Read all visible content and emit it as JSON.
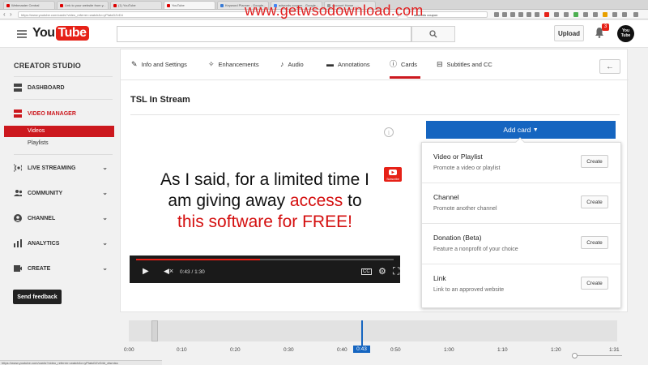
{
  "browser": {
    "tabs": [
      {
        "label": "Webmaster Central"
      },
      {
        "label": "Link to your website from y..."
      },
      {
        "label": "(1) YouTube"
      },
      {
        "label": "YouTube"
      },
      {
        "label": "Keyword Planner - Google..."
      },
      {
        "label": "adwords coupon - Google..."
      },
      {
        "label": "Account Home - ..."
      }
    ],
    "url": "https://www.youtube.com/cards?video_referrer=watch&v=yPlatoDZvD4",
    "search_value": "adwords coupon",
    "status_url": "https://www.youtube.com/cards?video_referrer=watch&v=yPlatoDZvD4#_dismiss"
  },
  "watermark": "www.getwsodownload.com",
  "header": {
    "logo_you": "You",
    "logo_tube": "Tube",
    "upload_label": "Upload",
    "notification_count": "3",
    "avatar_text": "You Tube"
  },
  "sidebar": {
    "title": "CREATOR STUDIO",
    "items": [
      {
        "label": "DASHBOARD"
      },
      {
        "label": "VIDEO MANAGER"
      },
      {
        "label": "LIVE STREAMING"
      },
      {
        "label": "COMMUNITY"
      },
      {
        "label": "CHANNEL"
      },
      {
        "label": "ANALYTICS"
      },
      {
        "label": "CREATE"
      }
    ],
    "subitems": [
      {
        "label": "Videos"
      },
      {
        "label": "Playlists"
      }
    ],
    "feedback_label": "Send feedback"
  },
  "tabs": [
    {
      "label": "Info and Settings"
    },
    {
      "label": "Enhancements"
    },
    {
      "label": "Audio"
    },
    {
      "label": "Annotations"
    },
    {
      "label": "Cards"
    },
    {
      "label": "Subtitles and CC"
    }
  ],
  "video": {
    "title": "TSL In Stream",
    "overlay_line1": "As I said, for a limited time I",
    "overlay_line2_a": "am giving away ",
    "overlay_line2_b": "access",
    "overlay_line2_c": " to",
    "overlay_line3": "this software for FREE!",
    "subscribe_label": "Subscribe",
    "time_display": "0:43 / 1:30",
    "progress": 0.48
  },
  "cards": {
    "add_label": "Add card",
    "items": [
      {
        "title": "Video or Playlist",
        "desc": "Promote a video or playlist",
        "button": "Create"
      },
      {
        "title": "Channel",
        "desc": "Promote another channel",
        "button": "Create"
      },
      {
        "title": "Donation (Beta)",
        "desc": "Feature a nonprofit of your choice",
        "button": "Create"
      },
      {
        "title": "Link",
        "desc": "Link to an approved website",
        "button": "Create"
      }
    ]
  },
  "timeline": {
    "current": "0:43",
    "ticks": [
      "0:00",
      "0:10",
      "0:20",
      "0:30",
      "0:40",
      "0:50",
      "1:00",
      "1:10",
      "1:20",
      "1:31"
    ]
  },
  "colors": {
    "brand_red": "#e62117",
    "accent_blue": "#1565c0"
  }
}
